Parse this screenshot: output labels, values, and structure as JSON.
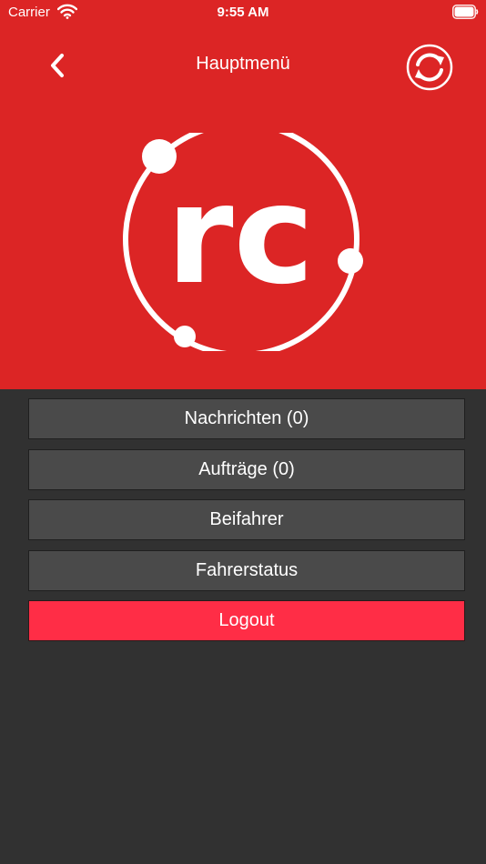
{
  "status_bar": {
    "carrier": "Carrier",
    "time": "9:55 AM"
  },
  "nav": {
    "title": "Hauptmenü",
    "back_icon": "chevron-left-icon",
    "sync_icon": "sync-icon"
  },
  "logo": {
    "text": "rc"
  },
  "menu": {
    "items": [
      {
        "label": "Nachrichten (0)"
      },
      {
        "label": "Aufträge (0)"
      },
      {
        "label": "Beifahrer"
      },
      {
        "label": "Fahrerstatus"
      }
    ],
    "logout_label": "Logout"
  },
  "colors": {
    "header": "#dc2525",
    "background": "#313131",
    "button": "#4a4a4a",
    "logout": "#ff2d46"
  }
}
